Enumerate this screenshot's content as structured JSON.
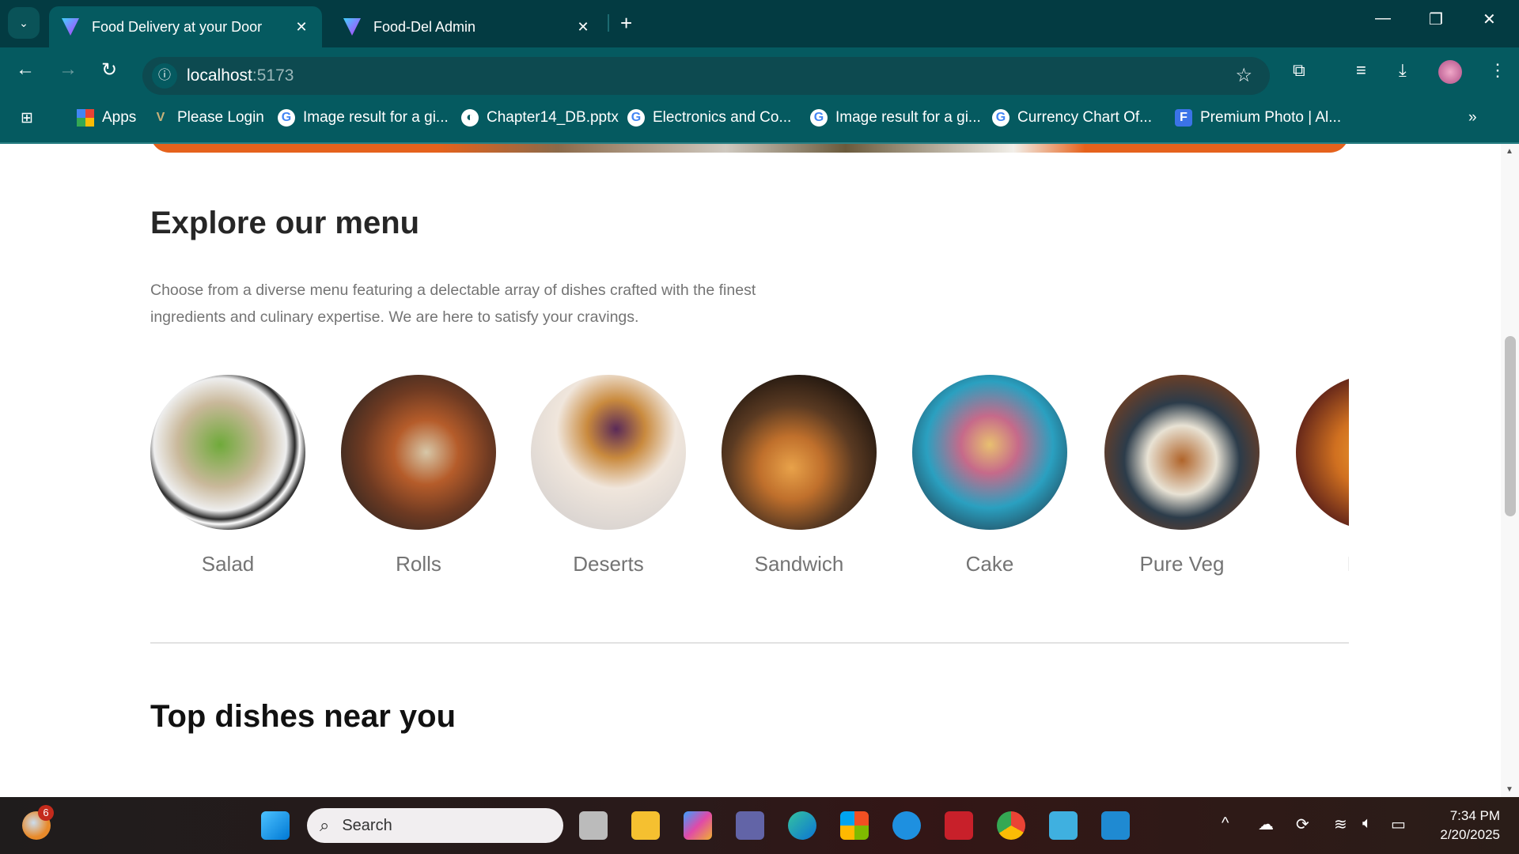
{
  "browser": {
    "tabs": [
      {
        "title": "Food Delivery at your Door",
        "active": true
      },
      {
        "title": "Food-Del Admin",
        "active": false
      }
    ],
    "url_host": "localhost",
    "url_port": ":5173",
    "bookmarks": [
      {
        "label": "Apps",
        "icon": "apps-grid-icon"
      },
      {
        "label": "Please Login",
        "icon": "v-logo-icon"
      },
      {
        "label": "Image result for a gi...",
        "icon": "google-icon"
      },
      {
        "label": "Chapter14_DB.pptx",
        "icon": "globe-icon"
      },
      {
        "label": "Electronics and Co...",
        "icon": "google-icon"
      },
      {
        "label": "Image result for a gi...",
        "icon": "google-icon"
      },
      {
        "label": "Currency Chart Of...",
        "icon": "google-icon"
      },
      {
        "label": "Premium Photo | Al...",
        "icon": "freepik-icon"
      }
    ]
  },
  "page": {
    "menu_title": "Explore our menu",
    "menu_description": "Choose from a diverse menu featuring a delectable array of dishes crafted with the finest ingredients and culinary expertise. We are here to satisfy your cravings.",
    "menu_items": [
      {
        "label": "Salad"
      },
      {
        "label": "Rolls"
      },
      {
        "label": "Deserts"
      },
      {
        "label": "Sandwich"
      },
      {
        "label": "Cake"
      },
      {
        "label": "Pure Veg"
      },
      {
        "label": "Pasta"
      }
    ],
    "top_dishes_title": "Top dishes near you",
    "accent_color": "#e5621c"
  },
  "taskbar": {
    "search_placeholder": "Search",
    "notification_count": "6",
    "time": "7:34 PM",
    "date": "2/20/2025"
  }
}
